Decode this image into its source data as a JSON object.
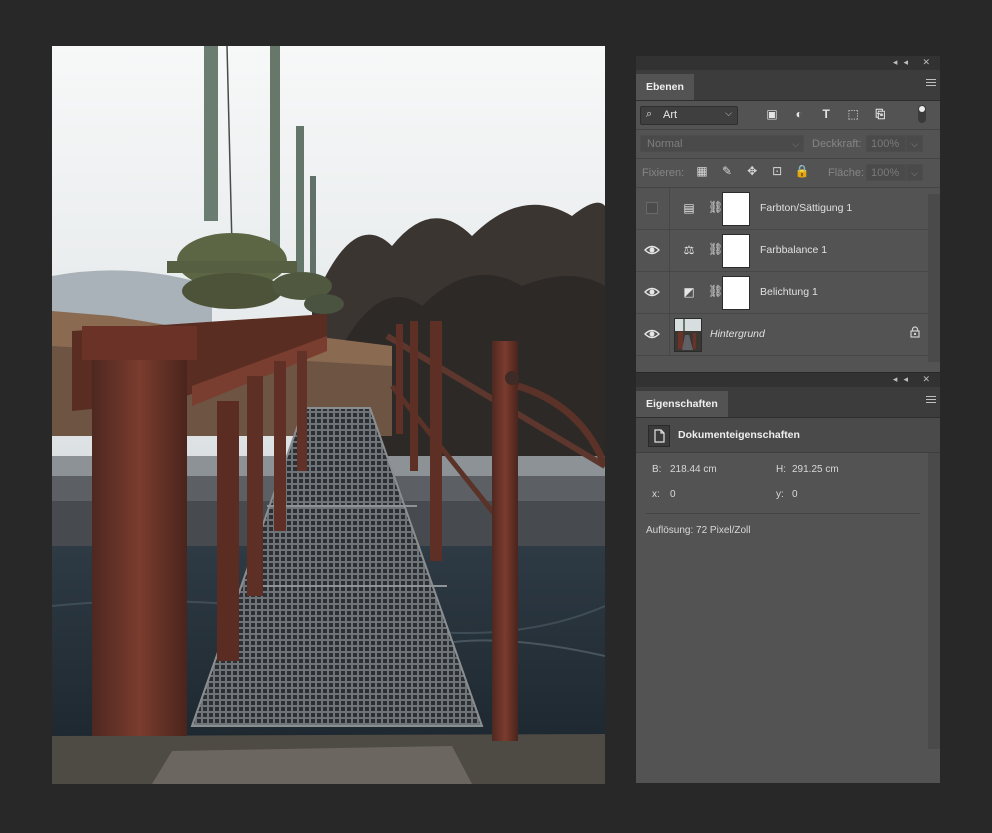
{
  "layers_panel": {
    "tab_label": "Ebenen",
    "filter": {
      "label": "Art",
      "search_icon": "search-icon",
      "chevron": "⌵"
    },
    "filter_icons": [
      "image-filter-icon",
      "adjustment-filter-icon",
      "type-filter-icon",
      "shape-filter-icon",
      "smart-object-filter-icon"
    ],
    "filter_glyphs": {
      "image": "▣",
      "adjust": "◐",
      "type": "T",
      "shape": "⬚",
      "smart": "⎘"
    },
    "blend_mode": "Normal",
    "opacity_label": "Deckkraft:",
    "opacity_value": "100%",
    "lock_label": "Fixieren:",
    "fill_label": "Fläche:",
    "fill_value": "100%",
    "lock_glyphs": {
      "pixels": "▦",
      "paint": "✎",
      "move": "✥",
      "artboard": "⊡",
      "all": "🔒"
    },
    "layers": [
      {
        "name": "Farbton/Sättigung 1",
        "visible": false,
        "type_icon": "hue-saturation-icon",
        "glyph": "▤"
      },
      {
        "name": "Farbbalance 1",
        "visible": true,
        "type_icon": "color-balance-icon",
        "glyph": "⚖"
      },
      {
        "name": "Belichtung 1",
        "visible": true,
        "type_icon": "exposure-icon",
        "glyph": "◩"
      },
      {
        "name": "Hintergrund",
        "visible": true,
        "type_icon": "image-thumbnail",
        "locked": true
      }
    ],
    "link_glyph": "⛓"
  },
  "properties_panel": {
    "tab_label": "Eigenschaften",
    "section_title": "Dokumenteigenschaften",
    "width_label": "B:",
    "width_value": "218.44 cm",
    "height_label": "H:",
    "height_value": "291.25 cm",
    "x_label": "x:",
    "x_value": "0",
    "y_label": "y:",
    "y_value": "0",
    "resolution": "Auflösung: 72 Pixel/Zoll"
  },
  "colors": {
    "workspace": "#282828",
    "panel": "#535353",
    "panel_dark": "#3c3c3c",
    "rust": "#6b3328"
  }
}
